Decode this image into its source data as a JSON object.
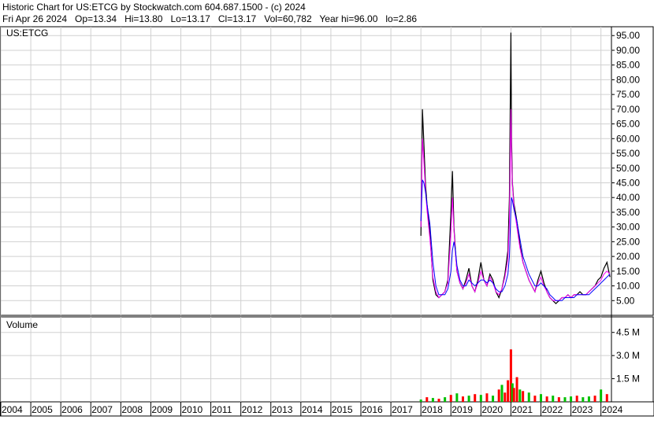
{
  "header": {
    "line1": "Historic Chart for US:ETCG by Stockwatch.com 604.687.1500 - (c) 2024",
    "line2": "Fri Apr 26 2024   Op=13.34   Hi=13.80   Lo=13.17   Cl=13.17   Vol=60,782   Year hi=96.00   lo=2.86"
  },
  "chart_data": [
    {
      "type": "line",
      "title": "US:ETCG",
      "price_labels": [
        "95.00",
        "90.00",
        "85.00",
        "80.00",
        "75.00",
        "70.00",
        "65.00",
        "60.00",
        "55.00",
        "50.00",
        "45.00",
        "40.00",
        "35.00",
        "30.00",
        "25.00",
        "20.00",
        "15.00",
        "10.00",
        "5.00"
      ],
      "ylim": [
        0,
        98
      ],
      "grid": true,
      "x": [
        2018.0,
        2018.05,
        2018.1,
        2018.15,
        2018.2,
        2018.3,
        2018.4,
        2018.5,
        2018.6,
        2018.7,
        2018.8,
        2018.9,
        2019.0,
        2019.05,
        2019.1,
        2019.15,
        2019.2,
        2019.3,
        2019.4,
        2019.5,
        2019.6,
        2019.7,
        2019.8,
        2019.9,
        2020.0,
        2020.1,
        2020.2,
        2020.3,
        2020.4,
        2020.5,
        2020.6,
        2020.7,
        2020.8,
        2020.9,
        2020.95,
        2021.0,
        2021.02,
        2021.05,
        2021.1,
        2021.2,
        2021.3,
        2021.4,
        2021.5,
        2021.6,
        2021.7,
        2021.8,
        2021.9,
        2022.0,
        2022.1,
        2022.2,
        2022.3,
        2022.4,
        2022.5,
        2022.6,
        2022.7,
        2022.8,
        2022.9,
        2023.0,
        2023.1,
        2023.2,
        2023.3,
        2023.4,
        2023.5,
        2023.6,
        2023.7,
        2023.8,
        2023.9,
        2024.0,
        2024.1,
        2024.2,
        2024.3
      ],
      "series": [
        {
          "color": "#000000",
          "values": [
            27,
            70,
            58,
            45,
            38,
            28,
            12,
            7,
            6,
            7,
            8,
            12,
            35,
            49,
            30,
            22,
            15,
            11,
            9,
            12,
            16,
            10,
            8,
            12,
            18,
            12,
            10,
            14,
            12,
            8,
            6,
            9,
            14,
            22,
            40,
            96,
            60,
            45,
            38,
            32,
            24,
            18,
            15,
            12,
            10,
            8,
            12,
            15,
            11,
            8,
            6,
            5,
            4,
            5,
            6,
            6,
            7,
            6,
            7,
            7,
            8,
            7,
            7,
            8,
            9,
            10,
            12,
            13,
            16,
            18,
            13
          ]
        },
        {
          "color": "#ff00ff",
          "values": [
            30,
            60,
            52,
            43,
            36,
            26,
            13,
            8,
            6,
            7,
            8,
            11,
            28,
            40,
            29,
            21,
            15,
            11,
            9,
            11,
            14,
            10,
            8,
            11,
            15,
            12,
            10,
            13,
            11,
            8,
            7,
            9,
            13,
            19,
            32,
            70,
            55,
            44,
            37,
            30,
            23,
            18,
            15,
            12,
            10,
            8,
            11,
            13,
            10,
            8,
            6,
            5,
            5,
            5,
            6,
            6,
            7,
            6,
            7,
            7,
            7,
            7,
            7,
            8,
            9,
            10,
            11,
            12,
            14,
            15,
            14
          ]
        },
        {
          "color": "#0000ff",
          "values": [
            32,
            46,
            45,
            42,
            38,
            31,
            18,
            10,
            7,
            7,
            7,
            9,
            15,
            22,
            25,
            22,
            17,
            12,
            10,
            10,
            12,
            11,
            10,
            11,
            12,
            12,
            11,
            12,
            11,
            9,
            8,
            8,
            10,
            14,
            20,
            36,
            40,
            39,
            36,
            32,
            26,
            20,
            17,
            14,
            12,
            10,
            10,
            11,
            10,
            9,
            7,
            6,
            5,
            5,
            5,
            6,
            6,
            6,
            6,
            7,
            7,
            7,
            7,
            7,
            8,
            9,
            10,
            11,
            12,
            13,
            14
          ]
        }
      ]
    },
    {
      "type": "bar",
      "title": "Volume",
      "volume_labels": [
        "4.5 M",
        "3.0 M",
        "1.5 M"
      ],
      "ylim": [
        0,
        5.2
      ],
      "x_labels": [
        "2004",
        "2005",
        "2006",
        "2007",
        "2008",
        "2009",
        "2010",
        "2011",
        "2012",
        "2013",
        "2014",
        "2015",
        "2016",
        "2017",
        "2018",
        "2019",
        "2020",
        "2021",
        "2022",
        "2023",
        "2024"
      ],
      "x": [
        2018.0,
        2018.2,
        2018.4,
        2018.6,
        2018.8,
        2019.0,
        2019.2,
        2019.4,
        2019.6,
        2019.8,
        2020.0,
        2020.2,
        2020.4,
        2020.6,
        2020.7,
        2020.8,
        2020.9,
        2021.0,
        2021.05,
        2021.1,
        2021.2,
        2021.3,
        2021.4,
        2021.6,
        2021.8,
        2022.0,
        2022.2,
        2022.4,
        2022.6,
        2022.8,
        2023.0,
        2023.2,
        2023.4,
        2023.6,
        2023.8,
        2024.0,
        2024.2
      ],
      "values": [
        0.15,
        0.3,
        0.25,
        0.2,
        0.3,
        0.45,
        0.55,
        0.35,
        0.4,
        0.5,
        0.45,
        0.55,
        0.4,
        0.8,
        1.1,
        0.6,
        1.4,
        3.4,
        1.2,
        0.9,
        1.6,
        0.8,
        0.7,
        0.6,
        0.4,
        0.5,
        0.35,
        0.4,
        0.3,
        0.3,
        0.35,
        0.4,
        0.3,
        0.35,
        0.4,
        0.8,
        0.5
      ],
      "up": [
        true,
        false,
        true,
        false,
        true,
        false,
        true,
        false,
        true,
        false,
        true,
        false,
        true,
        false,
        true,
        false,
        false,
        false,
        true,
        false,
        false,
        true,
        false,
        true,
        false,
        true,
        false,
        true,
        false,
        true,
        true,
        false,
        true,
        true,
        false,
        true,
        false
      ]
    }
  ]
}
